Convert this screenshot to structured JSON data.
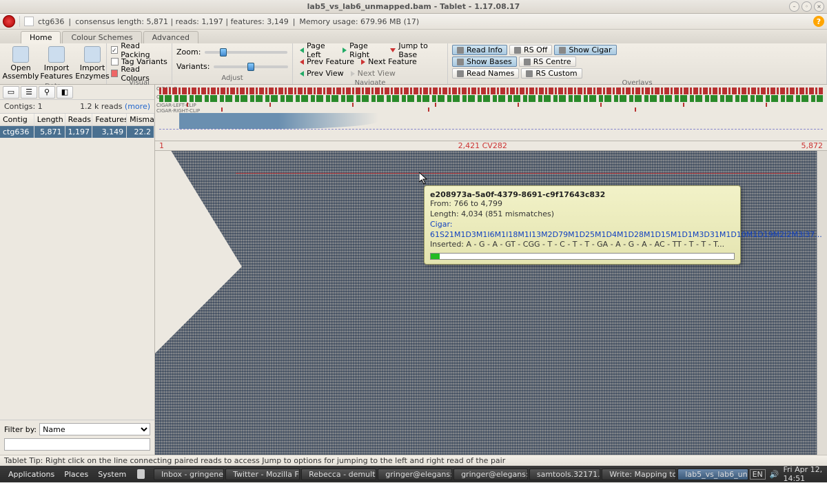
{
  "title": "lab5_vs_lab6_unmapped.bam - Tablet - 1.17.08.17",
  "topbar": {
    "contig": "ctg636",
    "stats": "consensus length: 5,871  |  reads: 1,197  |  features: 3,149",
    "memory": "Memory usage: 679.96 MB (17)"
  },
  "tabs": {
    "home": "Home",
    "colour": "Colour Schemes",
    "advanced": "Advanced"
  },
  "ribbon": {
    "data": {
      "label": "Data",
      "open": "Open\nAssembly",
      "importFeatures": "Import\nFeatures",
      "importEnzymes": "Import\nEnzymes"
    },
    "visual": {
      "label": "Visual",
      "readPacking": "Read Packing",
      "tagVariants": "Tag Variants",
      "readColours": "Read Colours"
    },
    "adjust": {
      "label": "Adjust",
      "zoom": "Zoom:",
      "variants": "Variants:"
    },
    "navigate": {
      "label": "Navigate",
      "pageLeft": "Page Left",
      "pageRight": "Page Right",
      "jump": "Jump to Base",
      "prevFeature": "Prev Feature",
      "nextFeature": "Next Feature",
      "prevView": "Prev View",
      "nextView": "Next View"
    },
    "overlays": {
      "label": "Overlays",
      "readInfo": "Read Info",
      "rsOff": "RS Off",
      "showCigar": "Show Cigar",
      "showBases": "Show Bases",
      "rsCentre": "RS Centre",
      "readNames": "Read Names",
      "rsCustom": "RS Custom"
    }
  },
  "sidebar": {
    "contigsLabel": "Contigs: 1",
    "readsLabel": "1.2 k reads",
    "more": "(more)",
    "headers": {
      "contig": "Contig",
      "length": "Length",
      "reads": "Reads",
      "features": "Features",
      "mismatch": "Mismat..."
    },
    "row": {
      "contig": "ctg636",
      "length": "5,871",
      "reads": "1,197",
      "features": "3,149",
      "mismatch": "22.2"
    },
    "filterLabel": "Filter by:",
    "filterMode": "Name"
  },
  "ruler": {
    "start": "1",
    "mid": "2,421 CV282",
    "end": "5,872"
  },
  "overview": {
    "cigarG": "CIGAR-G",
    "cigarI": "CIGAR-I",
    "cigarLeft": "CIGAR-LEFT-CLIP",
    "cigarRight": "CIGAR-RIGHT-CLIP"
  },
  "tooltip": {
    "title": "e208973a-5a0f-4379-8691-c9f17643c832",
    "from": "From: 766 to 4,799",
    "length": "Length: 4,034 (851 mismatches)",
    "cigar": "Cigar: 61S21M1D3M1I6M1I18M1I13M2D79M1D25M1D4M1D28M1D15M1D1M3D31M1D10M1D19M2I2M3I37...",
    "inserted": "Inserted: A - G - A - GT - CGG - T - C - T - T - GA - A - G - A - AC - TT - T - T - T..."
  },
  "tipbar": "Tablet Tip: Right click on the line connecting paired reads to access Jump to options for jumping to the left and right read of the pair",
  "taskbar": {
    "apps": "Applications",
    "places": "Places",
    "system": "System",
    "tasks": [
      "Inbox - gringene...",
      "Twitter - Mozilla Fi...",
      "Rebecca - demulti...",
      "gringer@elegans:...",
      "gringer@elegans:...",
      "samtools.32171....",
      "Write: Mapping to...",
      "lab5_vs_lab6_un..."
    ],
    "lang": "EN",
    "clock": "Fri Apr 12, 14:51"
  }
}
